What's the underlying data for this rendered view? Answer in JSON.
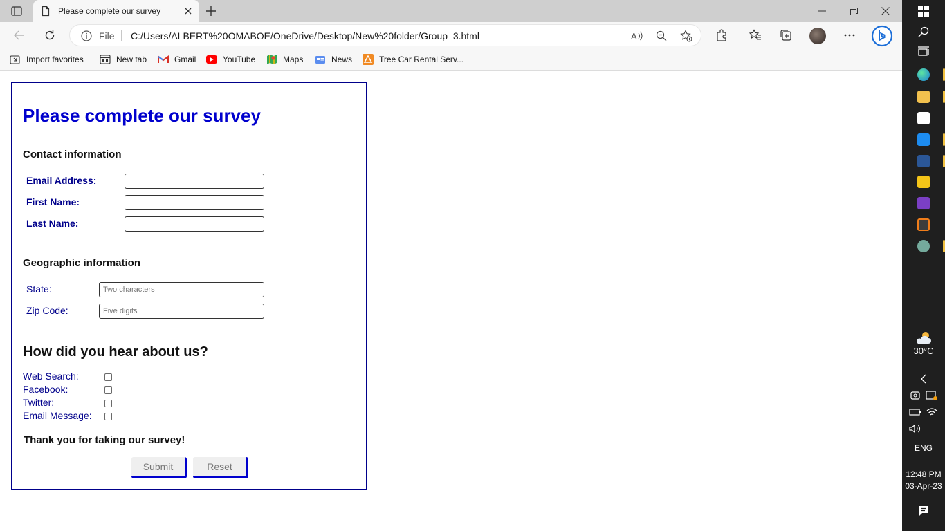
{
  "browser": {
    "tab_title": "Please complete our survey",
    "address": {
      "scheme_label": "File",
      "url": "C:/Users/ALBERT%20OMABOE/OneDrive/Desktop/New%20folder/Group_3.html"
    },
    "favorites": [
      {
        "label": "Import favorites",
        "icon": "import-icon"
      },
      {
        "label": "New tab",
        "icon": "new-tab-icon"
      },
      {
        "label": "Gmail",
        "icon": "gmail-icon"
      },
      {
        "label": "YouTube",
        "icon": "youtube-icon"
      },
      {
        "label": "Maps",
        "icon": "maps-icon"
      },
      {
        "label": "News",
        "icon": "news-icon"
      },
      {
        "label": "Tree Car Rental Serv...",
        "icon": "tree-car-icon"
      }
    ]
  },
  "survey": {
    "title": "Please complete our survey",
    "contact": {
      "heading": "Contact information",
      "fields": [
        {
          "label": "Email Address:",
          "value": ""
        },
        {
          "label": "First Name:",
          "value": ""
        },
        {
          "label": "Last Name:",
          "value": ""
        }
      ]
    },
    "geo": {
      "heading": "Geographic information",
      "fields": [
        {
          "label": "State:",
          "placeholder": "Two characters",
          "value": ""
        },
        {
          "label": "Zip Code:",
          "placeholder": "Five digits",
          "value": ""
        }
      ]
    },
    "hear": {
      "heading": "How did you hear about us?",
      "options": [
        {
          "label": "Web Search:",
          "checked": false
        },
        {
          "label": "Facebook:",
          "checked": false
        },
        {
          "label": "Twitter:",
          "checked": false
        },
        {
          "label": "Email Message:",
          "checked": false
        }
      ]
    },
    "thanks": "Thank you for taking our survey!",
    "submit_label": "Submit",
    "reset_label": "Reset"
  },
  "taskbar": {
    "weather_temp": "30°C",
    "language": "ENG",
    "time": "12:48 PM",
    "date": "03-Apr-23"
  },
  "colors": {
    "accent": "#0000cd",
    "label": "#00008b",
    "taskbar_bg": "#1f1f1f",
    "chrome_bg": "#f7f7f7"
  }
}
